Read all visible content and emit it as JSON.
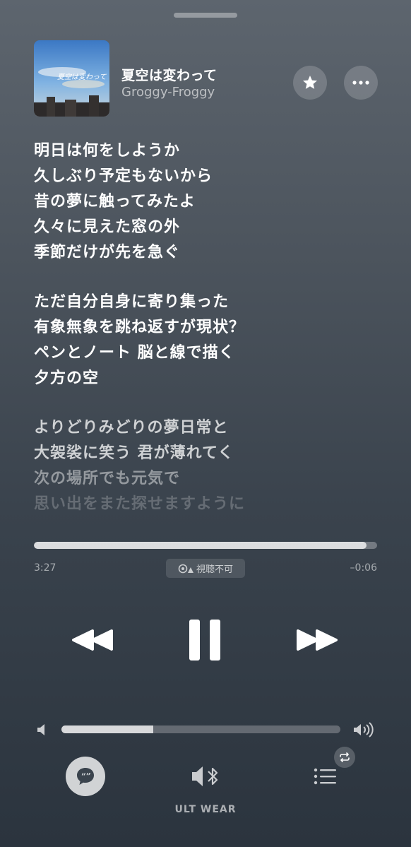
{
  "track": {
    "title": "夏空は変わって",
    "artist": "Groggy-Froggy"
  },
  "lyrics": [
    [
      "明日は何をしようか",
      "久しぶり予定もないから",
      "昔の夢に触ってみたよ",
      "久々に見えた窓の外",
      "季節だけが先を急ぐ"
    ],
    [
      "ただ自分自身に寄り集った",
      "有象無象を跳ね返すが現状？",
      "ペンとノート 脳と線で描く",
      "夕方の空"
    ],
    [
      "よりどりみどりの夢日常と",
      "大袈裟に笑う 君が薄れてく",
      "次の場所でも元気で",
      "思い出をまた探せますように"
    ]
  ],
  "playback": {
    "elapsed": "3:27",
    "remaining": "–0:06",
    "progress_fraction": 0.97,
    "status_badge": "視聴不可",
    "volume_fraction": 0.33
  },
  "output": {
    "device_name": "ULT WEAR"
  },
  "icons": {
    "favorite": "star-icon",
    "more": "ellipsis-icon",
    "rewind": "rewind-icon",
    "pause": "pause-icon",
    "forward": "fast-forward-icon",
    "lyrics": "lyrics-quote-icon",
    "airplay": "speaker-bluetooth-icon",
    "queue": "list-icon",
    "repeat": "repeat-icon"
  }
}
